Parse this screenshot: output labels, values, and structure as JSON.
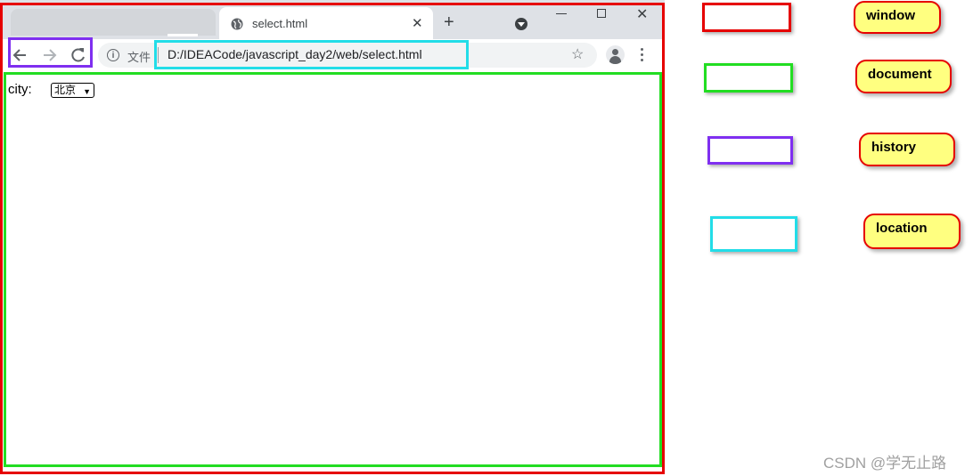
{
  "browser": {
    "tab_title": "select.html",
    "tab_icon": "globe-icon",
    "address_label": "文件",
    "url": "D:/IDEACode/javascript_day2/web/select.html"
  },
  "page": {
    "city_label": "city:",
    "city_selected": "北京"
  },
  "legend": [
    {
      "label": "window",
      "color": "#e60000"
    },
    {
      "label": "document",
      "color": "#22dd22"
    },
    {
      "label": "history",
      "color": "#7f2ff0"
    },
    {
      "label": "location",
      "color": "#22dde8"
    }
  ],
  "watermark": "CSDN @学无止路"
}
